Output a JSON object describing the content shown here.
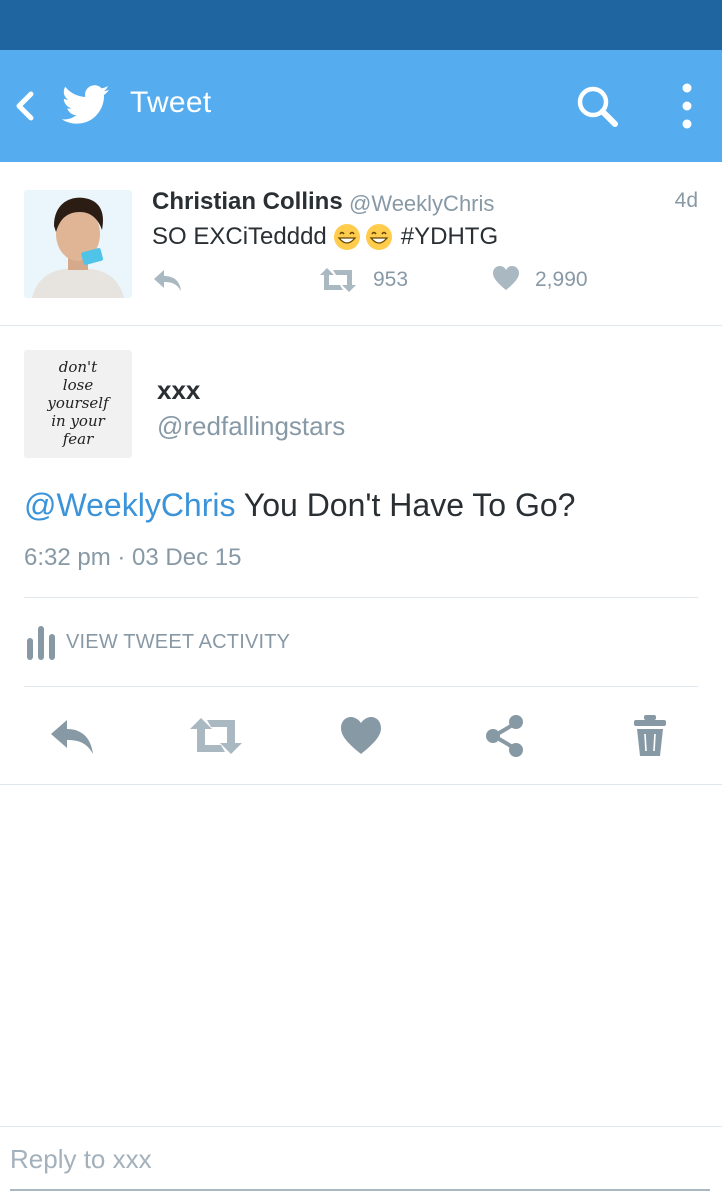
{
  "app_bar": {
    "title": "Tweet",
    "color": "#55acee",
    "status_bar_color": "#1f65a0",
    "icons": [
      "back-icon",
      "twitter-bird-icon",
      "search-icon",
      "overflow-menu-icon"
    ]
  },
  "parent_tweet": {
    "name": "Christian Collins",
    "handle": "@WeeklyChris",
    "time": "4d",
    "text": "SO EXCiTedddd",
    "emojis": [
      "grinning-face-icon",
      "grinning-face-icon"
    ],
    "hashtag": "#YDHTG",
    "retweets": "953",
    "likes": "2,990"
  },
  "main_tweet": {
    "name": "xxx",
    "handle": "@redfallingstars",
    "avatar_lines": [
      "don't",
      "lose",
      "yourself",
      "in your",
      "fear"
    ],
    "mention": "@WeeklyChris",
    "text": " You Don't Have To Go?",
    "timestamp": "6:32 pm · 03 Dec 15",
    "activity_label": "VIEW TWEET ACTIVITY",
    "action_icons": [
      "reply-icon",
      "retweet-icon",
      "like-icon",
      "share-icon",
      "delete-icon"
    ]
  },
  "reply": {
    "placeholder": "Reply to xxx"
  },
  "colors": {
    "accent": "#3b94d9",
    "icon_gray": "#8899a6",
    "text": "#292f33"
  }
}
